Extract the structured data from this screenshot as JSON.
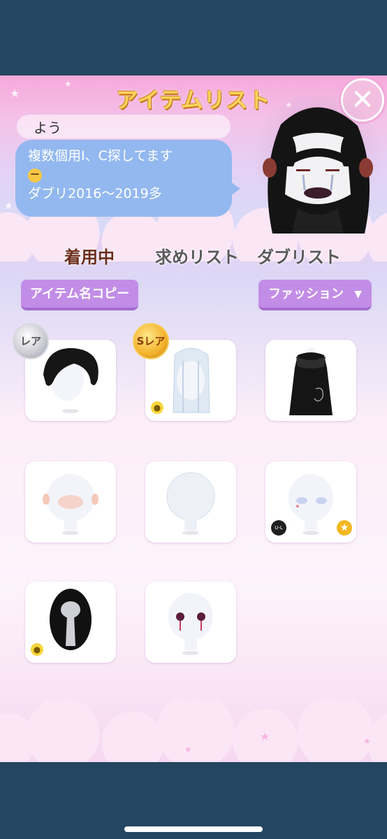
{
  "window": {
    "title": "アイテムリスト",
    "close_label": "✕"
  },
  "profile": {
    "name": "よう",
    "message_line1": "複数個用I、C探してます",
    "message_line3": "ダブリ2016〜2019多"
  },
  "tabs": [
    {
      "label": "着用中",
      "active": true
    },
    {
      "label": "求めリスト",
      "active": false
    },
    {
      "label": "ダブリスト",
      "active": false
    }
  ],
  "actions": {
    "copy_label": "アイテム名コピー",
    "filter_label": "ファッション",
    "filter_caret": "▼"
  },
  "items": [
    {
      "type": "black-hair",
      "badge": "レア",
      "badge_kind": "rare"
    },
    {
      "type": "white-hair",
      "badge": "Sレア",
      "badge_kind": "srare",
      "bulb": true
    },
    {
      "type": "black-dress"
    },
    {
      "type": "face-blush"
    },
    {
      "type": "face-plain"
    },
    {
      "type": "face-blue-eyes",
      "ul_badge": "U-L",
      "star_badge": true
    },
    {
      "type": "dark-oval",
      "bulb": true
    },
    {
      "type": "face-red-eyes"
    }
  ],
  "badges": {
    "rare": "レア",
    "srare": "Sレア",
    "ul": "U-L",
    "bulb_icon": "lightbulb-icon",
    "star_icon": "star-icon"
  },
  "colors": {
    "frame_bg": "#244660",
    "button_purple": "#c28de6",
    "bubble_blue": "#93b8ef",
    "title_gold": "#fbd45c"
  }
}
